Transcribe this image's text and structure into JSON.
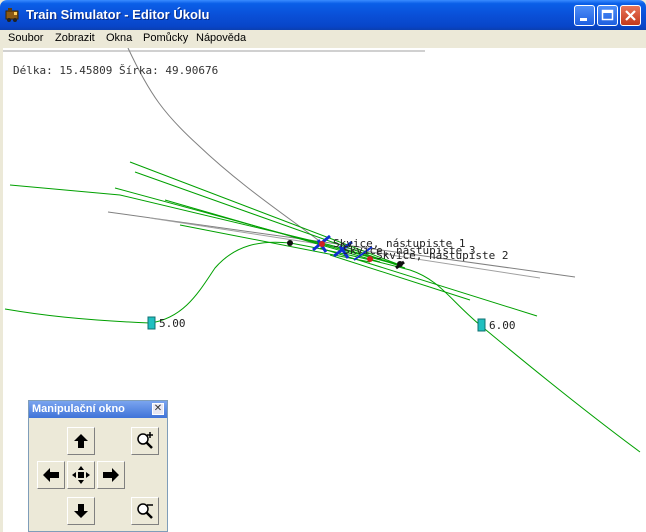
{
  "window": {
    "title": "Train Simulator - Editor Úkolu",
    "icon": "train-app-icon"
  },
  "menu": [
    "Soubor",
    "Zobrazit",
    "Okna",
    "Pomůcky",
    "Nápověda"
  ],
  "map": {
    "coords_text": "Délka: 15.45809 Šírka: 49.90676",
    "labels": {
      "station1": "Skvice, nástupiste 1",
      "station3": "Skvice, nástupiste 3",
      "station2": "Skvice, nástupiste 2",
      "marker_left": "5.00",
      "marker_right": "6.00"
    }
  },
  "panel": {
    "title": "Manipulační okno",
    "buttons": [
      "arrow-up-icon",
      "zoom-in-icon",
      "arrow-left-icon",
      "move-center-icon",
      "arrow-right-icon",
      "arrow-down-icon",
      "zoom-out-icon"
    ]
  },
  "colors": {
    "titlebar": "#0a50d8",
    "track": "#00a000",
    "wire": "#808080"
  }
}
